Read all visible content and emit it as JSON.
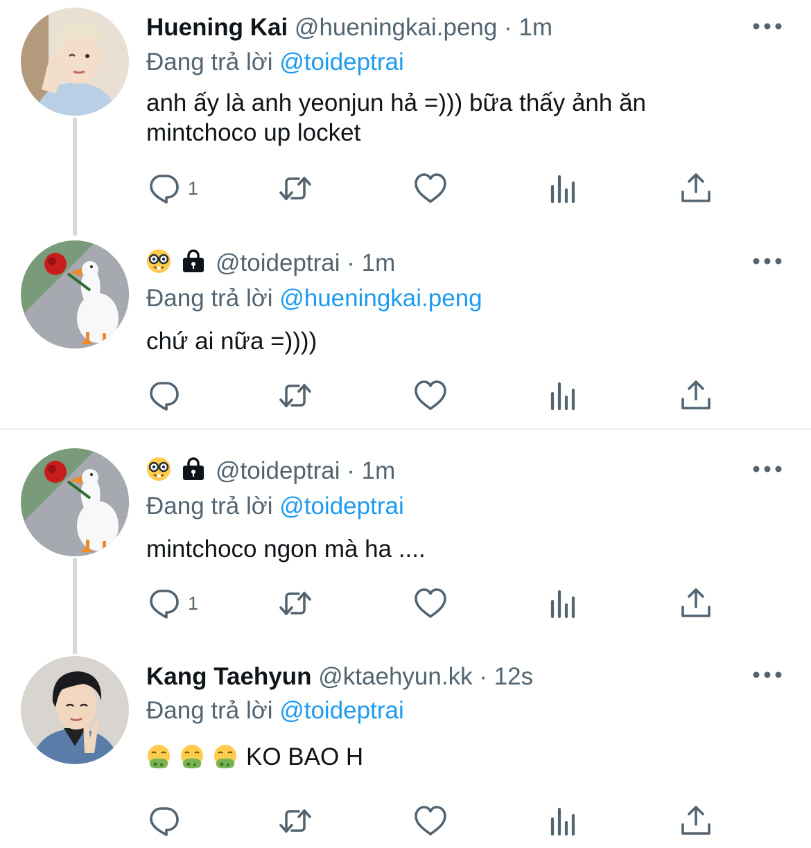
{
  "tweets": [
    {
      "display_name": "Huening Kai",
      "handle": "@hueningkai.peng",
      "separator": " · ",
      "time": "1m",
      "reply_prefix": "Đang trả lời ",
      "reply_mention": "@toideptrai",
      "text": "anh ấy là anh yeonjun hả =))) bữa thấy ảnh ăn mintchoco up locket",
      "reply_count": "1",
      "avatar": "person-blond-avatar"
    },
    {
      "display_name": "",
      "handle": "@toideptrai",
      "separator": " · ",
      "time": "1m",
      "reply_prefix": "Đang trả lời ",
      "reply_mention": "@hueningkai.peng",
      "text": "chứ ai nữa =))))",
      "reply_count": "",
      "avatar": "goose-avatar"
    },
    {
      "display_name": "",
      "handle": "@toideptrai",
      "separator": " · ",
      "time": "1m",
      "reply_prefix": "Đang trả lời ",
      "reply_mention": "@toideptrai",
      "text": "mintchoco ngon mà ha ....",
      "reply_count": "1",
      "avatar": "goose-avatar"
    },
    {
      "display_name": "Kang Taehyun",
      "handle": "@ktaehyun.kk",
      "separator": " · ",
      "time": "12s",
      "reply_prefix": "Đang trả lời ",
      "reply_mention": "@toideptrai",
      "text": "KO BAO H",
      "reply_count": "",
      "avatar": "person-dark-hair-avatar"
    }
  ],
  "icons": {
    "reply": "reply-icon",
    "retweet": "retweet-icon",
    "like": "heart-icon",
    "views": "views-icon",
    "share": "share-icon",
    "more": "more-icon",
    "nerd_emoji": "nerd-face-emoji",
    "lock": "lock-icon",
    "vomit_emoji": "vomit-face-emoji"
  },
  "colors": {
    "text_primary": "#0f1419",
    "text_secondary": "#536471",
    "link": "#1d9bf0",
    "thread_line": "#cfd9de"
  }
}
